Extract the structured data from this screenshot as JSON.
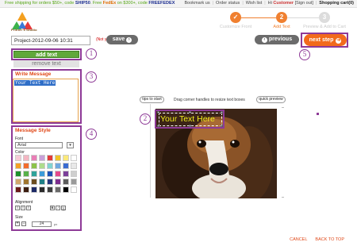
{
  "topbar": {
    "promo_pre": "Free shipping for orders $50+, code ",
    "code1": "SHIP50",
    "promo_mid": ". Free ",
    "fedex": "FedEx",
    "promo_post": " on $300+, code ",
    "code2": "FREEFEDEX",
    "bookmark": "Bookmark us",
    "order_status": "Order status",
    "wish_list": "Wish list",
    "hi": "Hi ",
    "customer": "Customer",
    "sign_out": "[Sign out]",
    "cart": "Shopping cart(0)"
  },
  "logo": {
    "text": "Printer's Studio"
  },
  "steps": [
    {
      "num": "✓",
      "label": "Customize Front",
      "state": "done"
    },
    {
      "num": "2",
      "label": "Add Text",
      "state": "active"
    },
    {
      "num": "3",
      "label": "Preview & Add to Cart",
      "state": "upcoming"
    }
  ],
  "project": {
    "name": "Project-2012-09-06 10:31",
    "not_saved": "(Not yet saved)",
    "save_label": "save",
    "save_arrow": "›"
  },
  "nav": {
    "previous_label": "previous",
    "previous_arrow": "‹",
    "next_label": "next step",
    "next_arrow": "➔"
  },
  "callouts": [
    "1",
    "2",
    "3",
    "4",
    "5"
  ],
  "text_tools": {
    "add_label": "add text",
    "remove_label": "remove text"
  },
  "write_message": {
    "title": "Write Message",
    "value": "Your Text Here"
  },
  "message_style": {
    "title": "Message Style",
    "font_label": "Font",
    "font_value": "Arial",
    "font_drop": "▾",
    "color_label": "Color",
    "colors": [
      "#f6c9d6",
      "#f4b6c2",
      "#e97eb6",
      "#c8a0d8",
      "#e23b3b",
      "#f0c42a",
      "#fbe97a",
      "#ffffff",
      "#f4a028",
      "#f26d2d",
      "#8bc34a",
      "#aedc8c",
      "#7fd3d1",
      "#6fa8e0",
      "#3a6bd1",
      "#e8e8e8",
      "#1e8f2e",
      "#57b04a",
      "#2fa39a",
      "#3d9bd8",
      "#1c4fb5",
      "#e44a8c",
      "#7b3f99",
      "#cfcfcf",
      "#d1a56e",
      "#a0762f",
      "#6b4d1f",
      "#1f7f86",
      "#25357d",
      "#7d2d8f",
      "#5c5c5c",
      "#9a9a9a",
      "#6b1a1a",
      "#3b1d10",
      "#1d2a66",
      "#2b2b2b",
      "#3d3d3d",
      "#6a6a6a",
      "#000000",
      "#ffffff"
    ],
    "alignment_label": "Alignment",
    "align_left": "≡",
    "align_center": "≡",
    "align_right": "≡",
    "bold": "B",
    "italic": "I",
    "underline": "U",
    "size_label": "Size",
    "size_plus": "+",
    "size_minus": "−",
    "size_value": "24",
    "size_unit": "px"
  },
  "canvas": {
    "tips_label": "tips to start",
    "hint": "Drag corner handles to resize text boxes",
    "preview_label": "quick preview",
    "overlay_text": "Your Text Here"
  },
  "footer": {
    "cancel": "CANCEL",
    "back_to_top": "BACK TO TOP"
  }
}
